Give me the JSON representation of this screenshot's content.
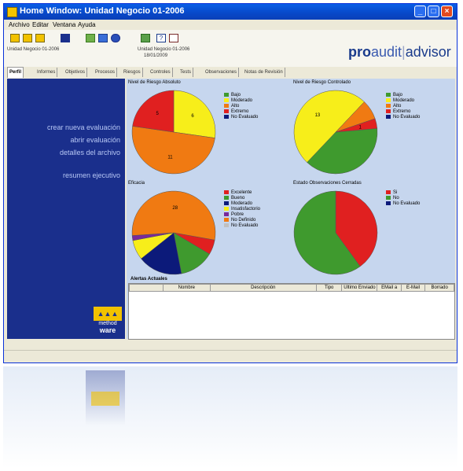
{
  "window": {
    "title": "Home Window: Unidad Negocio 01-2006"
  },
  "menu": [
    "Archivo",
    "Editar",
    "Ventana",
    "Ayuda"
  ],
  "toolbar": {
    "unit_label": "Unidad Negocio 01-2006",
    "unit2_label": "Unidad Negocio 01-2006",
    "date_label": "18/01/2009"
  },
  "brand": {
    "pro": "pro",
    "audit": "audit",
    "sep": "|",
    "advisor": "advisor"
  },
  "tabs": [
    "Perfil",
    "Informes",
    "Objetivos",
    "Procesos",
    "Riesgos",
    "Controles",
    "Tests",
    "Observaciones",
    "Notas de Revisión"
  ],
  "nav": {
    "new_eval": "crear nueva evaluación",
    "open_eval": "abrir evaluación",
    "file_details": "detalles del archivo",
    "summary": "resumen ejecutivo"
  },
  "company_logo": {
    "line1": "method",
    "line2": "ware"
  },
  "colors": {
    "green": "#3f9a2e",
    "yellow": "#f7ee1a",
    "orange": "#f07a12",
    "red": "#e02020",
    "navy": "#0c1a7a",
    "purple": "#7a2a9a",
    "gray": "#c0c0c0",
    "accent": "#1a2f8c"
  },
  "charts": {
    "absolute": {
      "title": "Nivel de Riesgo Absoluto",
      "legend": [
        "Bajo",
        "Moderado",
        "Alto",
        "Extremo",
        "No Evaluado"
      ],
      "values": [
        0,
        6,
        11,
        5,
        0
      ],
      "labels": [
        "",
        "6",
        "11",
        "5",
        ""
      ]
    },
    "controlled": {
      "title": "Nivel de Riesgo Controlado",
      "legend": [
        "Bajo",
        "Moderado",
        "Alto",
        "Extremo",
        "No Evaluado"
      ],
      "values": [
        10,
        13,
        2,
        1,
        0
      ],
      "labels": [
        "",
        "13",
        "",
        "1",
        ""
      ]
    },
    "efficacy": {
      "title": "Eficacia",
      "legend": [
        "Excelente",
        "Bueno",
        "Moderado",
        "Insatisfactorio",
        "Pobre",
        "No Definido",
        "No Evaluado"
      ],
      "values": [
        3,
        7,
        9,
        4,
        1,
        28,
        0
      ],
      "labels": [
        "",
        "",
        "",
        "",
        "",
        "28",
        ""
      ]
    },
    "observations": {
      "title": "Estado Observaciones Cerradas",
      "legend": [
        "Si",
        "No",
        "No Evaluado"
      ],
      "values": [
        4,
        6,
        0
      ],
      "labels": [
        "",
        "",
        ""
      ]
    }
  },
  "alerts": {
    "title": "Alertas Actuales",
    "columns": [
      "",
      "Nombre",
      "Descripción",
      "Tipo",
      "Ultimo Enviado",
      "EMail a",
      "E-Mail",
      "Borrado"
    ]
  }
}
